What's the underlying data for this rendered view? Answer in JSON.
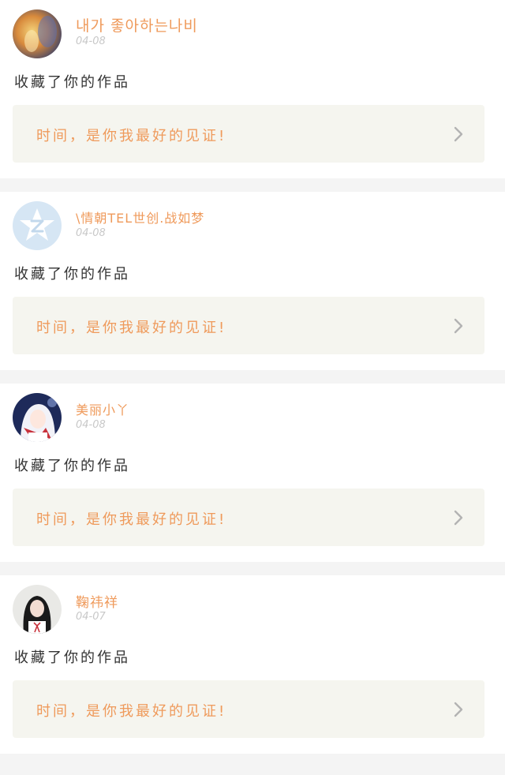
{
  "feed": {
    "items": [
      {
        "user_name": "내가 좋아하는나비",
        "time": "04-08",
        "action": "收藏了你的作品",
        "work_title": "时间，是你我最好的见证!",
        "avatar_icon": "avatar-photo-abstract"
      },
      {
        "user_name": "\\情朝TEL世创.战如梦",
        "time": "04-08",
        "action": "收藏了你的作品",
        "work_title": "时间，是你我最好的见证!",
        "avatar_icon": "default-avatar-icon"
      },
      {
        "user_name": "美丽小丫",
        "time": "04-08",
        "action": "收藏了你的作品",
        "work_title": "时间，是你我最好的见证!",
        "avatar_icon": "avatar-anime-girl"
      },
      {
        "user_name": "鞠祎祥",
        "time": "04-07",
        "action": "收藏了你的作品",
        "work_title": "时间，是你我最好的见证!",
        "avatar_icon": "avatar-photo-portrait"
      }
    ]
  },
  "colors": {
    "accent": "#ef9a5b",
    "card_bg": "#f5f5ef",
    "divider_bg": "#f4f4f4",
    "time_text": "#c8c8c8"
  }
}
